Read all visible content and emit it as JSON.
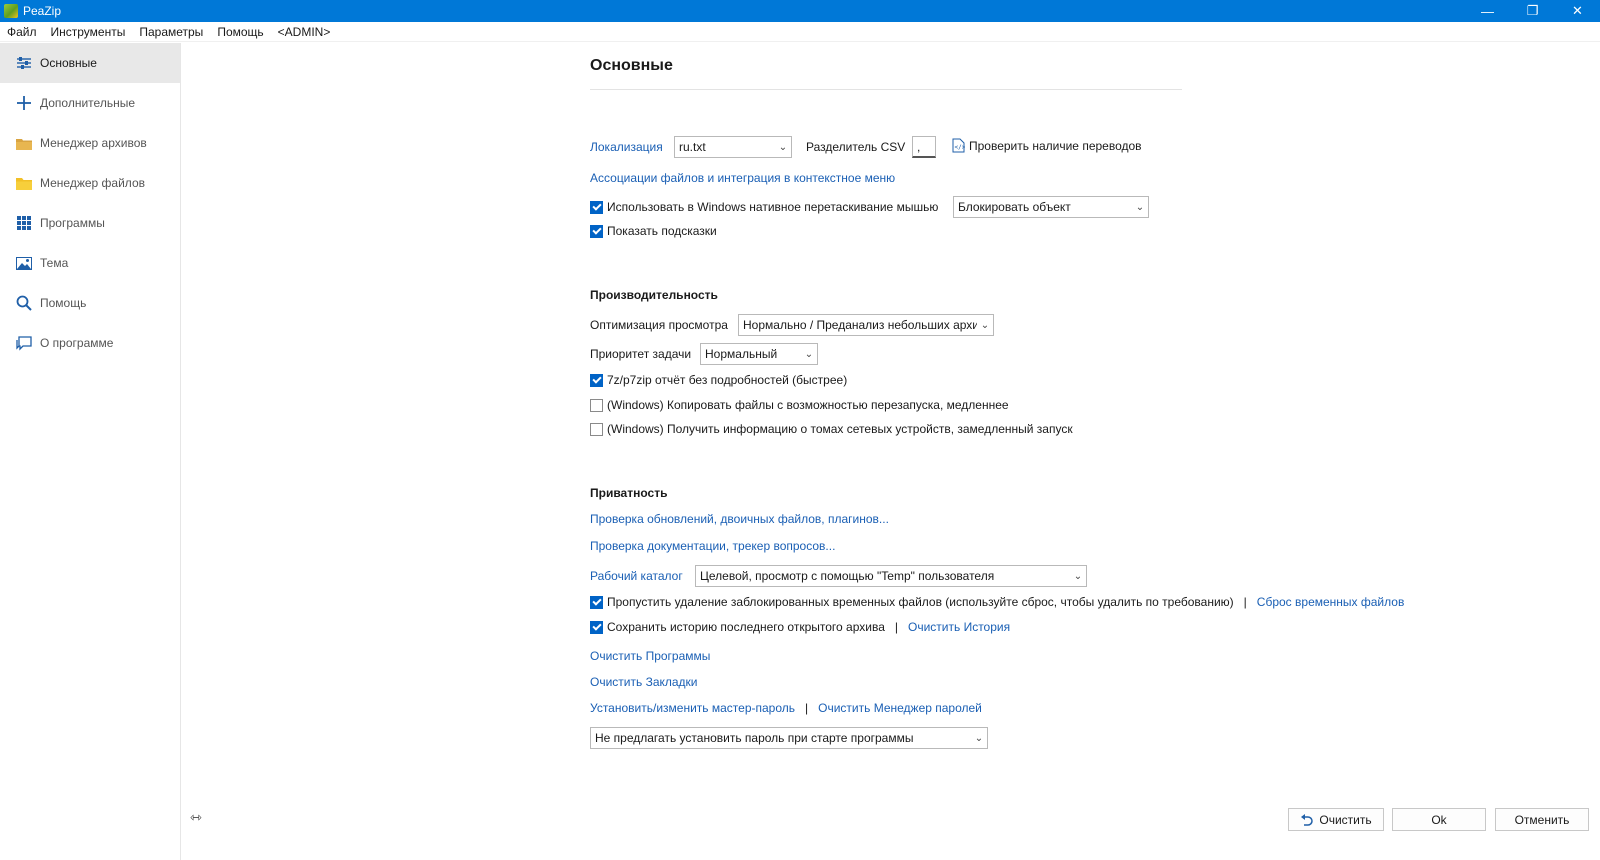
{
  "window": {
    "title": "PeaZip",
    "controls": [
      "—",
      "❐",
      "✕"
    ]
  },
  "menu": [
    "Файл",
    "Инструменты",
    "Параметры",
    "Помощь",
    "<ADMIN>"
  ],
  "sidebar": {
    "items": [
      {
        "label": "Основные",
        "icon": "sliders-icon",
        "active": true
      },
      {
        "label": "Дополнительные",
        "icon": "plus-icon"
      },
      {
        "label": "Менеджер архивов",
        "icon": "archive-folder-icon"
      },
      {
        "label": "Менеджер файлов",
        "icon": "folder-icon"
      },
      {
        "label": "Программы",
        "icon": "grid-icon"
      },
      {
        "label": "Тема",
        "icon": "image-icon"
      },
      {
        "label": "Помощь",
        "icon": "search-icon"
      },
      {
        "label": "О программе",
        "icon": "chat-icon"
      }
    ]
  },
  "main": {
    "title": "Основные",
    "general": {
      "localization_label": "Локализация",
      "localization_value": "ru.txt",
      "csv_label": "Разделитель CSV",
      "csv_value": ",",
      "check_translations": "Проверить наличие переводов",
      "associations_link": "Ассоциации файлов и интеграция в контекстное меню",
      "native_drag_label": "Использовать в Windows нативное перетаскивание мышью",
      "native_drag_checked": true,
      "drag_mode_value": "Блокировать объект",
      "show_hints_label": "Показать подсказки",
      "show_hints_checked": true
    },
    "performance": {
      "heading": "Производительность",
      "preview_opt_label": "Оптимизация просмотра",
      "preview_opt_value": "Нормально / Преданализ небольших архи",
      "priority_label": "Приоритет задачи",
      "priority_value": "Нормальный",
      "report_label": "7z/p7zip отчёт без подробностей (быстрее)",
      "report_checked": true,
      "copy_restart_label": "(Windows) Копировать файлы с возможностью перезапуска, медленнее",
      "copy_restart_checked": false,
      "volume_info_label": "(Windows) Получить информацию о томах сетевых устройств, замедленный запуск",
      "volume_info_checked": false
    },
    "privacy": {
      "heading": "Приватность",
      "updates_link": "Проверка обновлений, двоичных файлов, плагинов...",
      "docs_link": "Проверка документации, трекер вопросов...",
      "workdir_label": "Рабочий каталог",
      "workdir_value": "Целевой, просмотр с помощью \"Temp\" пользователя",
      "skip_delete_label": "Пропустить удаление заблокированных временных файлов (используйте сброс, чтобы удалить по требованию)",
      "skip_delete_checked": true,
      "reset_temp_link": "Сброс временных файлов",
      "save_history_label": "Сохранить историю последнего открытого архива",
      "save_history_checked": true,
      "clear_history_link": "Очистить История",
      "clear_programs_link": "Очистить Программы",
      "clear_bookmarks_link": "Очистить Закладки",
      "master_password_link": "Установить/изменить мастер-пароль",
      "clear_password_manager_link": "Очистить Менеджер паролей",
      "password_prompt_value": "Не предлагать установить пароль при старте программы",
      "separator": "|"
    }
  },
  "footer": {
    "clear_label": "Очистить",
    "ok_label": "Ok",
    "cancel_label": "Отменить"
  }
}
